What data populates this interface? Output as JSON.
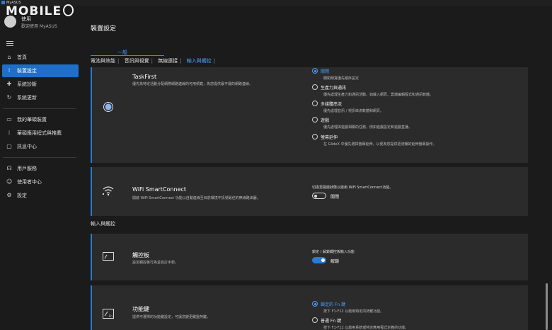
{
  "window": {
    "title": "MyASUS"
  },
  "watermark": {
    "text": "MOBILE"
  },
  "user": {
    "name": "使用",
    "greeting": "歡迎使用 MyASUS"
  },
  "sidebar": {
    "items": [
      {
        "label": "首頁",
        "icon": "home-icon"
      },
      {
        "label": "裝置設定",
        "icon": "settings-grid-icon",
        "active": true
      },
      {
        "label": "系統診斷",
        "icon": "diagnosis-icon"
      },
      {
        "label": "系統更新",
        "icon": "refresh-icon"
      },
      {
        "label": "我的華碩裝置",
        "icon": "device-icon"
      },
      {
        "label": "華碩應用程式與推薦",
        "icon": "apps-icon"
      },
      {
        "label": "訊息中心",
        "icon": "message-icon"
      },
      {
        "label": "用戶服務",
        "icon": "support-icon"
      },
      {
        "label": "使用者中心",
        "icon": "user-icon"
      },
      {
        "label": "設定",
        "icon": "gear-icon"
      }
    ]
  },
  "page": {
    "title": "裝置設定"
  },
  "tabs": {
    "general": "一般"
  },
  "subtabs": [
    {
      "label": "電池與效能"
    },
    {
      "label": "音訊與視覺"
    },
    {
      "label": "無線連接"
    },
    {
      "label": "輸入與觸控",
      "active": true
    }
  ],
  "taskfirst": {
    "title": "TaskFirst",
    "desc": "優先為特定活動分配網際網路連線的可用頻寬，為您提供最平穩的網路連線。",
    "options": [
      {
        "label": "關閉",
        "desc": "關閉頻寬優先順序設定",
        "selected": true
      },
      {
        "label": "生產力與通訊",
        "desc": "優先處理生產力和通訊活動，如載入網頁、雲端編輯程式和通訊軟體。"
      },
      {
        "label": "多媒體串流",
        "desc": "優先處理音訊 / 視訊串流軟體和網頁。"
      },
      {
        "label": "遊戲",
        "desc": "優先處理與遊戲相關的任務，例如遊戲設定和遊戲直播。"
      },
      {
        "label": "螢幕延伸",
        "desc": "在 GlideX 中優先選擇螢幕延伸，以便為您提供更流暢的延伸螢幕操作。"
      }
    ]
  },
  "wifi": {
    "title": "WiFi SmartConnect",
    "desc": "開啟 WiFi SmartConnect 功能以自動連線至目前環境中訊號最佳的無線路由器。",
    "hint": "切換至開啟狀態以啟用 WiFi SmartConnect功能。",
    "toggle_label": "關閉",
    "toggle_on": false
  },
  "section": {
    "input_touch": "輸入與觸控"
  },
  "touchpad": {
    "title": "觸控板",
    "desc": "設定觸控板行為並自訂手勢。",
    "hint": "鎖定 / 解鎖觸控板輸入功能",
    "toggle_label": "解鎖",
    "toggle_on": true
  },
  "fnkey": {
    "title": "功能鍵",
    "desc": "提供可選擇的功能鍵設定，可讓您變更鍵盤熱鍵。",
    "options": [
      {
        "label": "鎖定的 Fn 鍵",
        "desc": "按下 F1-F12 以啟用特定的熱鍵功能。",
        "selected": true
      },
      {
        "label": "普通 Fn 鍵",
        "desc": "按下 F1-F12 以啟用系統或特定應用程式定義的功能。"
      }
    ]
  },
  "colors": {
    "accent": "#2a7ad6",
    "link": "#4a9eff",
    "card": "#2b2b2b",
    "background": "#1b1b1b"
  }
}
